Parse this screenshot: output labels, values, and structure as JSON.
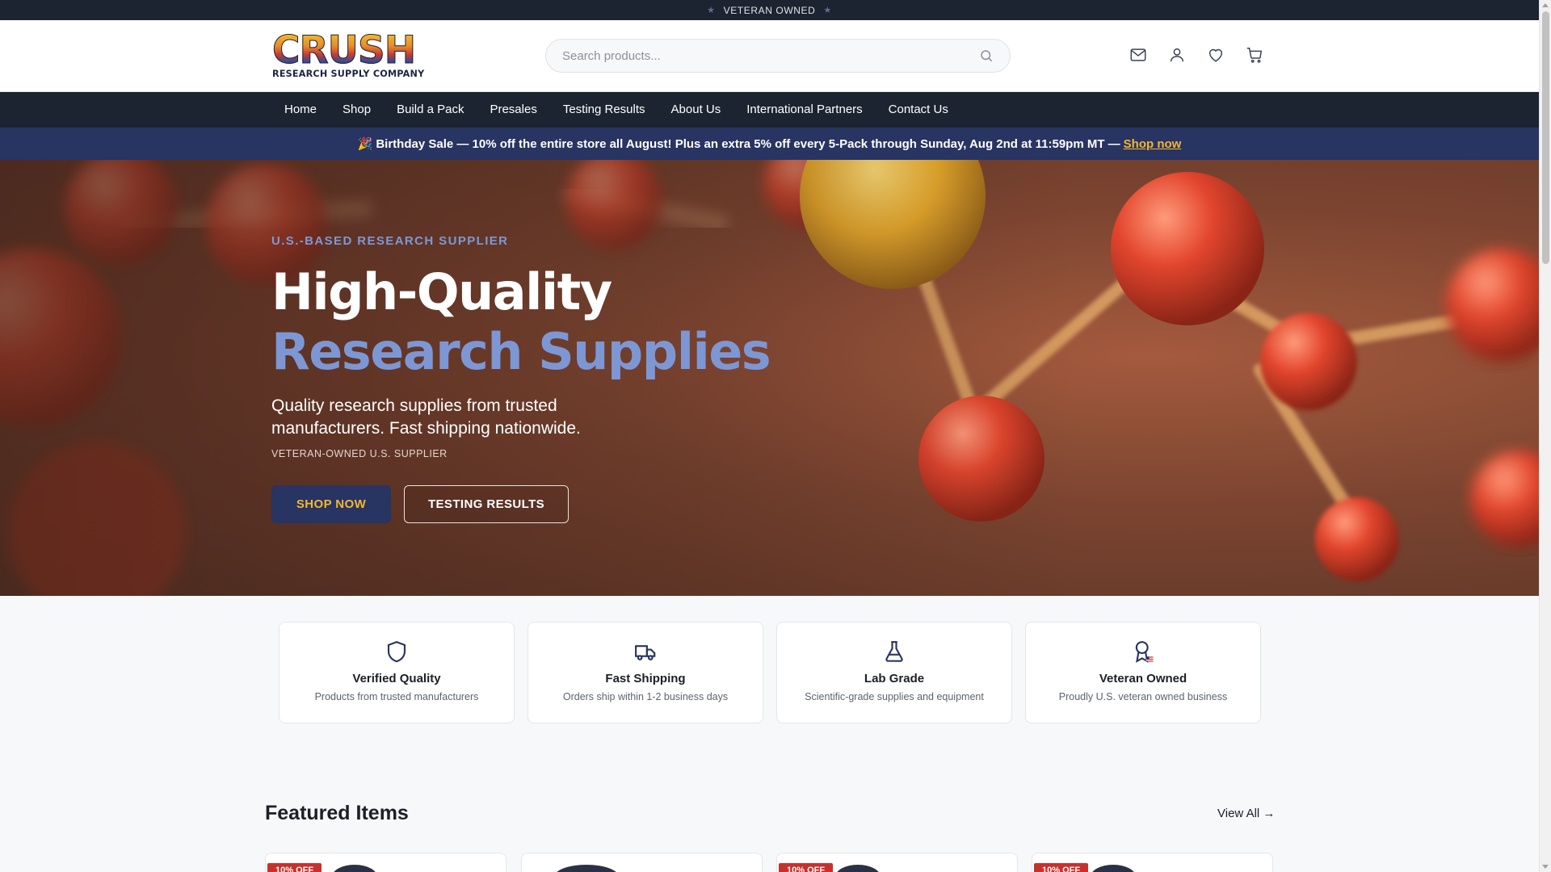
{
  "topbar": {
    "text": "VETERAN OWNED"
  },
  "header": {
    "logo_word": "CRUSH",
    "logo_sub": "RESEARCH SUPPLY COMPANY",
    "search_placeholder": "Search products..."
  },
  "nav": {
    "items": [
      {
        "label": "Home"
      },
      {
        "label": "Shop"
      },
      {
        "label": "Build a Pack"
      },
      {
        "label": "Presales"
      },
      {
        "label": "Testing Results"
      },
      {
        "label": "About Us"
      },
      {
        "label": "International Partners"
      },
      {
        "label": "Contact Us"
      }
    ]
  },
  "promo": {
    "emoji": "🎉",
    "text": "Birthday Sale — 10% off the entire store all August! Plus an extra 5% off every 5-Pack through Sunday, Aug 2nd at 11:59pm MT —",
    "link": "Shop now"
  },
  "hero": {
    "eyebrow": "U.S.-BASED RESEARCH SUPPLIER",
    "title_line1": "High-Quality",
    "title_line2": "Research Supplies",
    "lead": "Quality research supplies from trusted manufacturers. Fast shipping nationwide.",
    "small": "VETERAN-OWNED U.S. SUPPLIER",
    "btn_primary": "SHOP NOW",
    "btn_secondary": "TESTING RESULTS"
  },
  "features": [
    {
      "icon": "shield-icon",
      "title": "Verified Quality",
      "desc": "Products from trusted manufacturers"
    },
    {
      "icon": "truck-icon",
      "title": "Fast Shipping",
      "desc": "Orders ship within 1-2 business days"
    },
    {
      "icon": "flask-icon",
      "title": "Lab Grade",
      "desc": "Scientific-grade supplies and equipment"
    },
    {
      "icon": "award-icon",
      "title": "Veteran Owned",
      "desc": "Proudly U.S. veteran owned business"
    }
  ],
  "featured": {
    "title": "Featured Items",
    "view_all": "View All →",
    "badges": [
      "10% OFF",
      "",
      "10% OFF",
      "10% OFF"
    ]
  },
  "colors": {
    "navy": "#1c2431",
    "brand_blue": "#283461",
    "accent_gold": "#f3b731",
    "hero_blue": "#7d97d5",
    "sale_red": "#c9302c"
  }
}
